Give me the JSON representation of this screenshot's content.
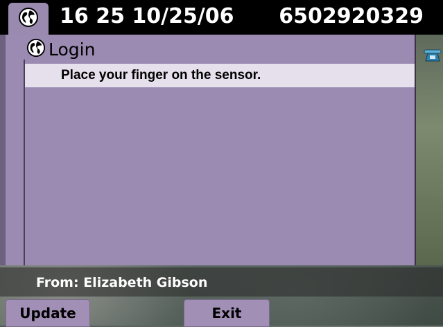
{
  "status_bar": {
    "datetime": "16 25 10/25/06",
    "phone_number": "6502920329",
    "icon": "globe-icon"
  },
  "panel": {
    "title": "Login",
    "title_icon": "globe-icon",
    "prompt": "Place your finger on the sensor."
  },
  "side": {
    "line_icon": "phone-icon"
  },
  "footer": {
    "from": "From: Elizabeth Gibson"
  },
  "softkeys": {
    "update": "Update",
    "exit": "Exit"
  },
  "colors": {
    "panel": "#9b8bb2",
    "prompt_bar": "#e5e0ec",
    "header": "#000000",
    "softkey": "#a28fb6"
  }
}
